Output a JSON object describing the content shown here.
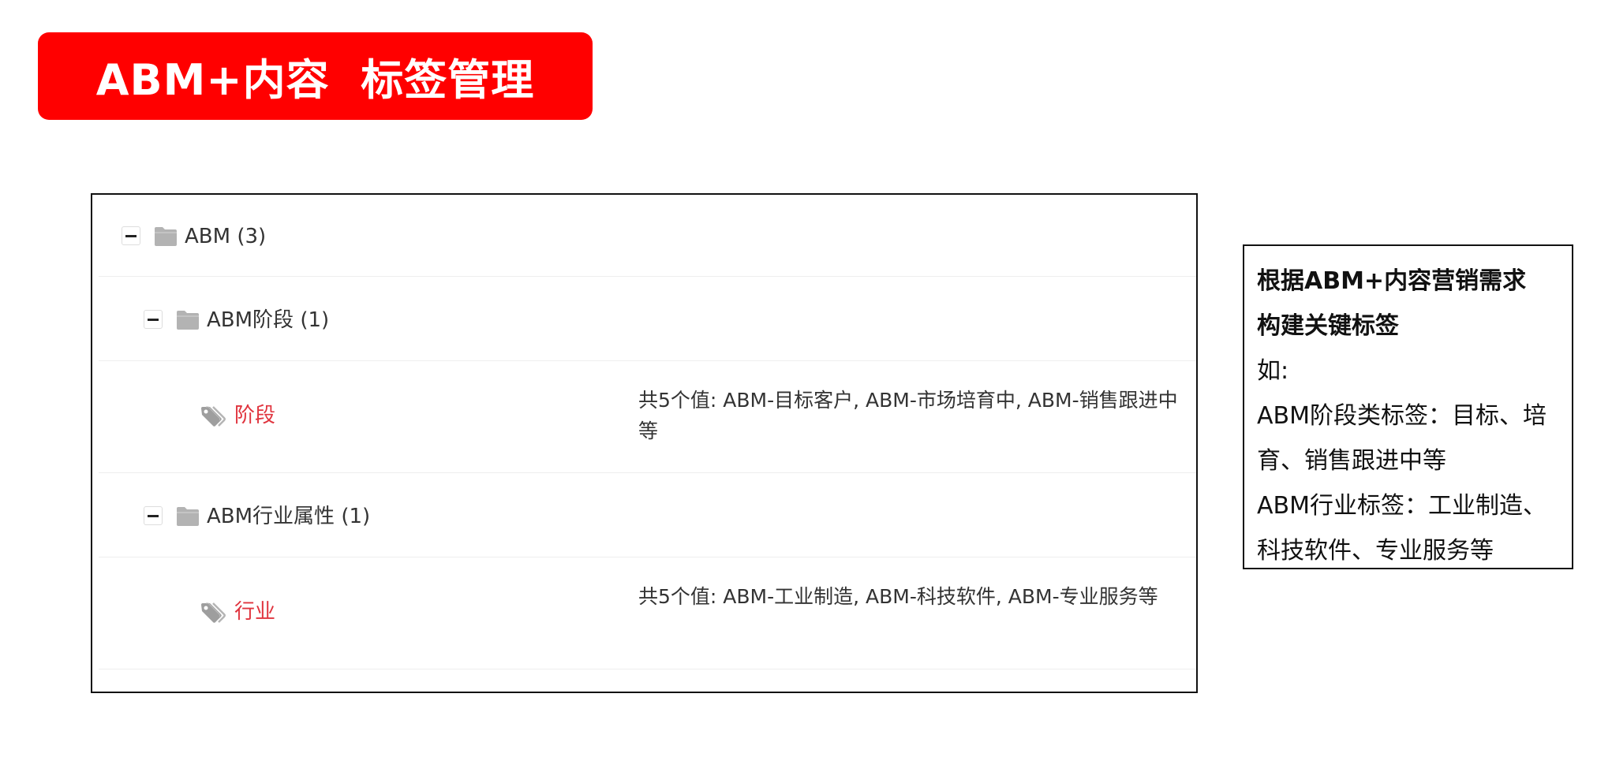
{
  "banner": {
    "title": "ABM+内容  标签管理",
    "color": "#ff0000"
  },
  "tree": {
    "root": {
      "label": "ABM (3)",
      "icon": "folder-icon",
      "expanded": true
    },
    "groups": [
      {
        "label": "ABM阶段 (1)",
        "icon": "folder-icon",
        "expanded": true,
        "tag": {
          "label": "阶段",
          "icon": "tag-icon",
          "description": "共5个值: ABM-目标客户, ABM-市场培育中, ABM-销售跟进中等"
        }
      },
      {
        "label": "ABM行业属性 (1)",
        "icon": "folder-icon",
        "expanded": true,
        "tag": {
          "label": "行业",
          "icon": "tag-icon",
          "description": "共5个值: ABM-工业制造, ABM-科技软件, ABM-专业服务等"
        }
      }
    ],
    "tag_color": "#e0343e"
  },
  "note": {
    "heading_line1": "根据ABM+内容营销需求",
    "heading_line2": "构建关键标签",
    "line_example": "如:",
    "line_stage_1": "ABM阶段类标签：目标、培",
    "line_stage_2": "育、销售跟进中等",
    "line_industry_1": "ABM行业标签：工业制造、",
    "line_industry_2": "科技软件、专业服务等"
  }
}
